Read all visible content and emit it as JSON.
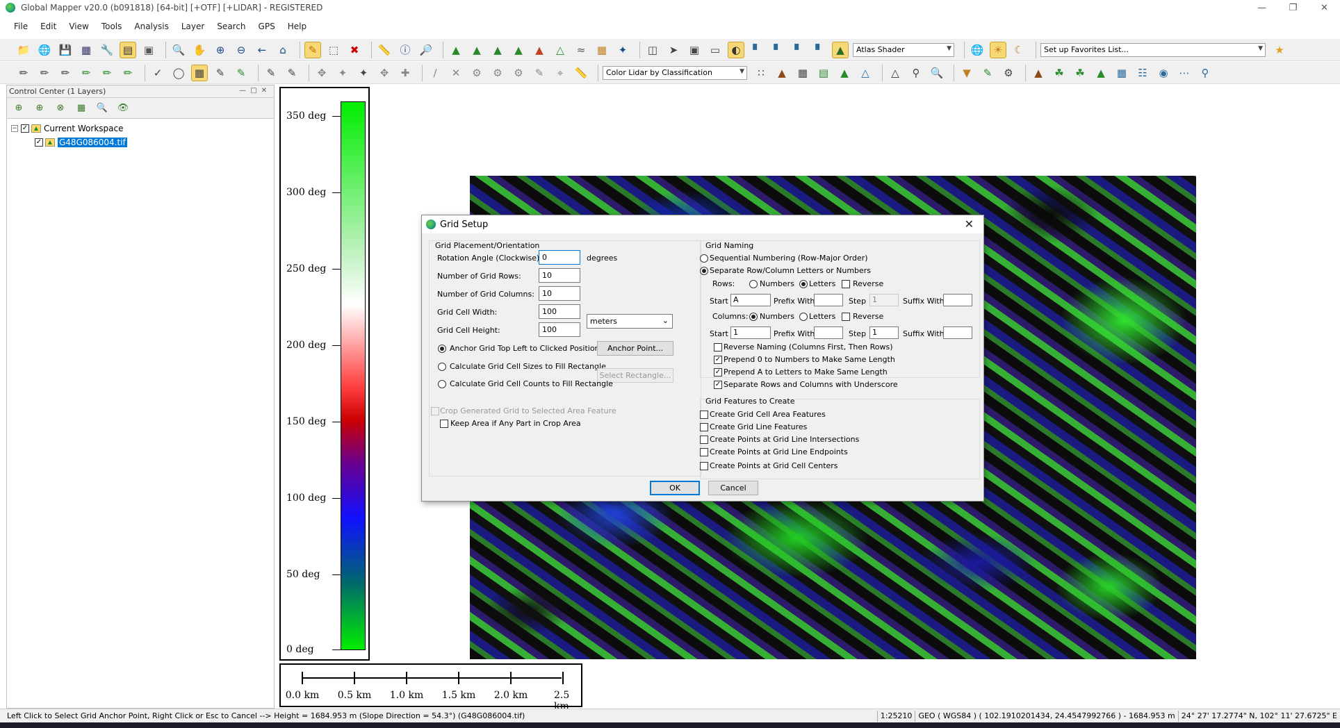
{
  "window": {
    "title": "Global Mapper v20.0 (b091818) [64-bit] [+OTF] [+LIDAR] - REGISTERED"
  },
  "menu": [
    "File",
    "Edit",
    "View",
    "Tools",
    "Analysis",
    "Layer",
    "Search",
    "GPS",
    "Help"
  ],
  "toolbar": {
    "shader_select": "Atlas Shader",
    "favorites_select": "Set up Favorites List...",
    "lidar_color_select": "Color Lidar by Classification"
  },
  "control_center": {
    "title": "Control Center (1 Layers)",
    "workspace": "Current Workspace",
    "layer": "G48G086004.tif"
  },
  "legend": {
    "labels": [
      "350 deg",
      "300 deg",
      "250 deg",
      "200 deg",
      "150 deg",
      "100 deg",
      "50 deg",
      "0 deg"
    ]
  },
  "scale_bar": {
    "labels": [
      "0.0 km",
      "0.5 km",
      "1.0 km",
      "1.5 km",
      "2.0 km",
      "2.5 km"
    ]
  },
  "dialog": {
    "title": "Grid Setup",
    "placement": {
      "group_label": "Grid Placement/Orientation",
      "rotation_label": "Rotation Angle (Clockwise):",
      "rotation_value": "0",
      "rotation_unit": "degrees",
      "rows_label": "Number of Grid Rows:",
      "rows_value": "10",
      "cols_label": "Number of Grid Columns:",
      "cols_value": "10",
      "width_label": "Grid Cell Width:",
      "width_value": "100",
      "height_label": "Grid Cell Height:",
      "height_value": "100",
      "unit_select": "meters",
      "anchor_top_left": "Anchor Grid Top Left to Clicked Position",
      "anchor_point_btn": "Anchor Point...",
      "calc_sizes": "Calculate Grid Cell Sizes to Fill Rectangle",
      "select_rect_btn": "Select Rectangle...",
      "calc_counts": "Calculate Grid Cell Counts to Fill Rectangle",
      "crop": "Crop Generated Grid to Selected Area Feature",
      "keep_area": "Keep Area if Any Part in Crop Area"
    },
    "naming": {
      "group_label": "Grid Naming",
      "sequential": "Sequential Numbering (Row-Major Order)",
      "separate": "Separate Row/Column Letters or Numbers",
      "rows_label": "Rows:",
      "numbers": "Numbers",
      "letters": "Letters",
      "reverse": "Reverse",
      "start": "Start",
      "prefix": "Prefix With",
      "step": "Step",
      "suffix": "Suffix With",
      "row_start": "A",
      "row_step": "1",
      "cols_label": "Columns:",
      "col_start": "1",
      "col_step": "1",
      "reverse_naming": "Reverse Naming (Columns First, Then Rows)",
      "prepend0": "Prepend 0 to Numbers to Make Same Length",
      "prependA": "Prepend A to Letters to Make Same Length",
      "underscore": "Separate Rows and Columns with Underscore"
    },
    "features": {
      "group_label": "Grid Features to Create",
      "cell_area": "Create Grid Cell Area Features",
      "line": "Create Grid Line Features",
      "intersections": "Create Points at Grid Line Intersections",
      "endpoints": "Create Points at Grid Line Endpoints",
      "centers": "Create Points at Grid Cell Centers"
    },
    "ok": "OK",
    "cancel": "Cancel"
  },
  "status": {
    "message": "Left Click to Select Grid Anchor Point, Right Click or Esc to Cancel --> Height = 1684.953 m (Slope Direction = 54.3°) (G48G086004.tif)",
    "scale": "1:25210",
    "coords": "GEO ( WGS84 ) ( 102.1910201434, 24.4547992766 ) - 1684.953 m",
    "dms": "24° 27' 17.2774\" N, 102° 11' 27.6725\" E"
  }
}
